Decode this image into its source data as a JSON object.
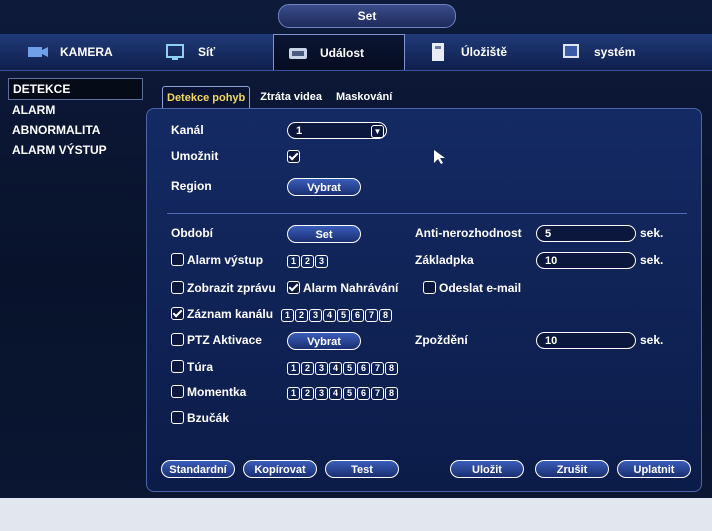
{
  "window": {
    "title": "Set"
  },
  "nav": [
    {
      "label": "KAMERA",
      "icon": "camera-icon"
    },
    {
      "label": "Síť",
      "icon": "network-icon"
    },
    {
      "label": "Událost",
      "icon": "event-icon"
    },
    {
      "label": "Úložiště",
      "icon": "storage-icon"
    },
    {
      "label": "systém",
      "icon": "system-icon"
    }
  ],
  "sidebar": [
    {
      "label": "DETEKCE"
    },
    {
      "label": "ALARM"
    },
    {
      "label": "ABNORMALITA"
    },
    {
      "label": "ALARM VÝSTUP"
    }
  ],
  "tabs": [
    {
      "label": "Detekce pohyb"
    },
    {
      "label": "Ztráta videa"
    },
    {
      "label": "Maskování"
    }
  ],
  "form": {
    "kanal_label": "Kanál",
    "kanal_value": "1",
    "umoznit_label": "Umožnit",
    "region_label": "Region",
    "region_button": "Vybrat",
    "obdobi_label": "Období",
    "obdobi_button": "Set",
    "antinero_label": "Anti-nerozhodnost",
    "antinero_value": "5",
    "antinero_unit": "sek.",
    "alarm_vystup_label": "Alarm výstup",
    "alarm_vystup_channels": [
      "1",
      "2",
      "3"
    ],
    "zakl_label": "Základpka",
    "zakl_value": "10",
    "zakl_unit": "sek.",
    "zobrazit_label": "Zobrazit zprávu",
    "alarm_nahr_label": "Alarm Nahrávání",
    "odeslat_label": "Odeslat e-mail",
    "zaznam_label": "Záznam kanálu",
    "channels8": [
      "1",
      "2",
      "3",
      "4",
      "5",
      "6",
      "7",
      "8"
    ],
    "ptz_label": "PTZ Aktivace",
    "ptz_button": "Vybrat",
    "zpozdeni_label": "Zpoždění",
    "zpozdeni_value": "10",
    "zpozdeni_unit": "sek.",
    "tura_label": "Túra",
    "momentka_label": "Momentka",
    "bzucak_label": "Bzučák"
  },
  "footer": {
    "standard": "Standardní",
    "kopirovat": "Kopírovat",
    "test": "Test",
    "ulozit": "Uložit",
    "zrusit": "Zrušit",
    "uplatnit": "Uplatnit"
  }
}
